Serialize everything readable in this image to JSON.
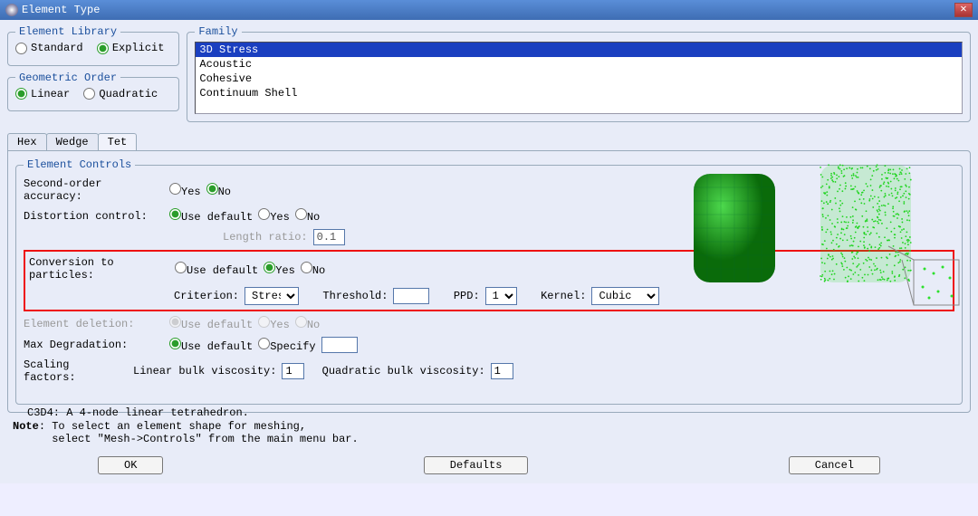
{
  "title": "Element Type",
  "groups": {
    "library": {
      "legend": "Element Library",
      "options": [
        "Standard",
        "Explicit"
      ],
      "selected": "Explicit"
    },
    "order": {
      "legend": "Geometric Order",
      "options": [
        "Linear",
        "Quadratic"
      ],
      "selected": "Linear"
    },
    "family": {
      "legend": "Family",
      "items": [
        "3D Stress",
        "Acoustic",
        "Cohesive",
        "Continuum Shell"
      ],
      "selected": "3D Stress"
    }
  },
  "tabs": {
    "items": [
      "Hex",
      "Wedge",
      "Tet"
    ],
    "active": "Tet"
  },
  "controls": {
    "legend": "Element Controls",
    "second_order": {
      "label": "Second-order accuracy:",
      "options": [
        "Yes",
        "No"
      ],
      "selected": "No"
    },
    "distortion": {
      "label": "Distortion control:",
      "options": [
        "Use default",
        "Yes",
        "No"
      ],
      "selected": "Use default",
      "length_label": "Length ratio:",
      "length_value": "0.1"
    },
    "conversion": {
      "label": "Conversion to particles:",
      "options": [
        "Use default",
        "Yes",
        "No"
      ],
      "selected": "Yes",
      "criterion_label": "Criterion:",
      "criterion": "Stress",
      "threshold_label": "Threshold:",
      "threshold": "",
      "ppd_label": "PPD:",
      "ppd": "1",
      "kernel_label": "Kernel:",
      "kernel": "Cubic"
    },
    "deletion": {
      "label": "Element deletion:",
      "options": [
        "Use default",
        "Yes",
        "No"
      ],
      "disabled": true
    },
    "maxdeg": {
      "label": "Max Degradation:",
      "options": [
        "Use default",
        "Specify"
      ],
      "selected": "Use default",
      "specify_value": ""
    },
    "scaling": {
      "label": "Scaling factors:",
      "lin_label": "Linear bulk viscosity:",
      "lin_value": "1",
      "quad_label": "Quadratic bulk viscosity:",
      "quad_value": "1"
    },
    "description": "C3D4:  A 4-node linear tetrahedron."
  },
  "note": {
    "prefix": "Note",
    "line1": ": To select an element shape for meshing,",
    "line2": "select \"Mesh->Controls\" from the main menu bar."
  },
  "buttons": {
    "ok": "OK",
    "defaults": "Defaults",
    "cancel": "Cancel"
  }
}
